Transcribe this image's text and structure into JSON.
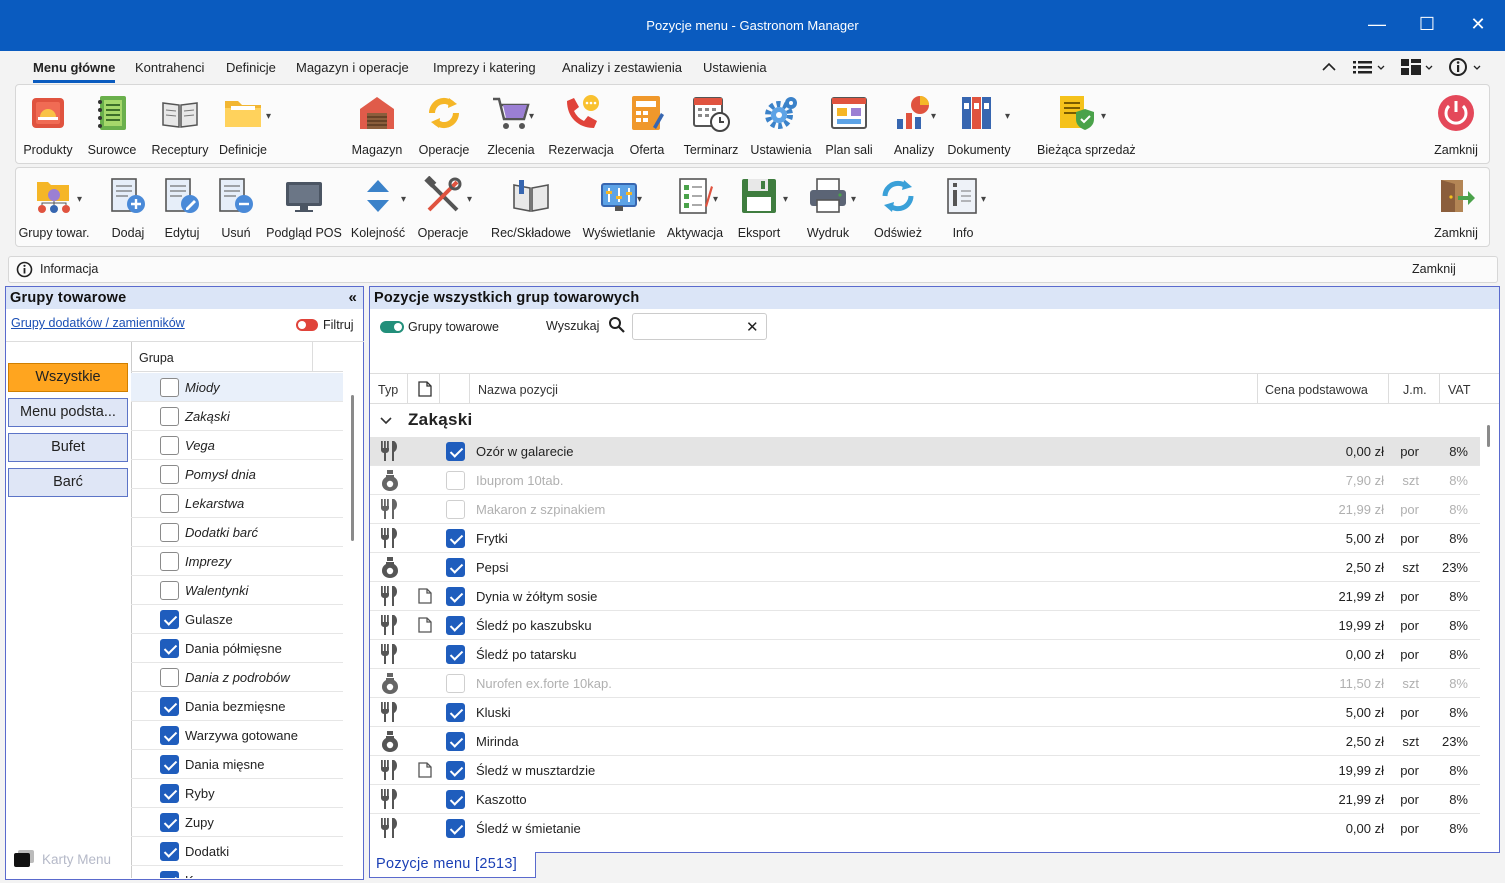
{
  "window": {
    "title": "Pozycje menu - Gastronom Manager",
    "min": "—",
    "max": "☐",
    "close": "✕"
  },
  "menu_tabs": [
    "Menu główne",
    "Kontrahenci",
    "Definicje",
    "Magazyn i operacje",
    "Imprezy i katering",
    "Analizy i zestawienia",
    "Ustawienia"
  ],
  "ribbon1": {
    "items": [
      "Produkty",
      "Surowce",
      "Receptury",
      "Definicje",
      "Magazyn",
      "Operacje",
      "Zlecenia",
      "Rezerwacja",
      "Oferta",
      "Terminarz",
      "Ustawienia",
      "Plan sali",
      "Analizy",
      "Dokumenty",
      "Bieżąca sprzedaż"
    ],
    "close": "Zamknij"
  },
  "ribbon2": {
    "items": [
      "Grupy towar.",
      "Dodaj",
      "Edytuj",
      "Usuń",
      "Podgląd POS",
      "Kolejność",
      "Operacje",
      "Rec/Składowe",
      "Wyświetlanie",
      "Aktywacja",
      "Eksport",
      "Wydruk",
      "Odśwież",
      "Info"
    ],
    "close": "Zamknij"
  },
  "info": {
    "label": "Informacja",
    "close": "Zamknij"
  },
  "left": {
    "title": "Grupy towarowe",
    "collapse": "«",
    "link": "Grupy dodatków / zamienników",
    "filter": "Filtruj",
    "col": "Grupa",
    "buttons": [
      "Wszystkie",
      "Menu podsta...",
      "Bufet",
      "Barć"
    ],
    "groups": [
      {
        "name": "Miody",
        "on": false
      },
      {
        "name": "Zakąski",
        "on": false
      },
      {
        "name": "Vega",
        "on": false
      },
      {
        "name": "Pomysł dnia",
        "on": false
      },
      {
        "name": "Lekarstwa",
        "on": false
      },
      {
        "name": "Dodatki barć",
        "on": false
      },
      {
        "name": "Imprezy",
        "on": false
      },
      {
        "name": "Walentynki",
        "on": false
      },
      {
        "name": "Gulasze",
        "on": true
      },
      {
        "name": "Dania półmięsne",
        "on": true
      },
      {
        "name": "Dania z podrobów",
        "on": false
      },
      {
        "name": "Dania bezmięsne",
        "on": true
      },
      {
        "name": "Warzywa gotowane",
        "on": true
      },
      {
        "name": "Dania mięsne",
        "on": true
      },
      {
        "name": "Ryby",
        "on": true
      },
      {
        "name": "Zupy",
        "on": true
      },
      {
        "name": "Dodatki",
        "on": true
      },
      {
        "name": "Kawy",
        "on": true
      }
    ],
    "karty": "Karty Menu"
  },
  "right": {
    "title": "Pozycje wszystkich grup towarowych",
    "toggle": "Grupy towarowe",
    "search_label": "Wyszukaj",
    "search_value": "",
    "cols": {
      "typ": "Typ",
      "name": "Nazwa pozycji",
      "price": "Cena podstawowa",
      "unit": "J.m.",
      "vat": "VAT"
    },
    "group": "Zakąski",
    "rows": [
      {
        "t": "fork",
        "doc": false,
        "on": true,
        "dim": false,
        "name": "Ozór w galarecie",
        "price": "0,00 zł",
        "unit": "por",
        "vat": "8%"
      },
      {
        "t": "bottle",
        "doc": false,
        "on": false,
        "dim": true,
        "name": "Ibuprom 10tab.",
        "price": "7,90 zł",
        "unit": "szt",
        "vat": "8%"
      },
      {
        "t": "fork",
        "doc": false,
        "on": false,
        "dim": true,
        "name": "Makaron z szpinakiem",
        "price": "21,99 zł",
        "unit": "por",
        "vat": "8%"
      },
      {
        "t": "fork",
        "doc": false,
        "on": true,
        "dim": false,
        "name": "Frytki",
        "price": "5,00 zł",
        "unit": "por",
        "vat": "8%"
      },
      {
        "t": "bottle",
        "doc": false,
        "on": true,
        "dim": false,
        "name": "Pepsi",
        "price": "2,50 zł",
        "unit": "szt",
        "vat": "23%"
      },
      {
        "t": "fork",
        "doc": true,
        "on": true,
        "dim": false,
        "name": "Dynia w żółtym sosie",
        "price": "21,99 zł",
        "unit": "por",
        "vat": "8%"
      },
      {
        "t": "fork",
        "doc": true,
        "on": true,
        "dim": false,
        "name": "Śledź po kaszubsku",
        "price": "19,99 zł",
        "unit": "por",
        "vat": "8%"
      },
      {
        "t": "fork",
        "doc": false,
        "on": true,
        "dim": false,
        "name": "Śledź po tatarsku",
        "price": "0,00 zł",
        "unit": "por",
        "vat": "8%"
      },
      {
        "t": "bottle",
        "doc": false,
        "on": false,
        "dim": true,
        "name": "Nurofen ex.forte 10kap.",
        "price": "11,50 zł",
        "unit": "szt",
        "vat": "8%"
      },
      {
        "t": "fork",
        "doc": false,
        "on": true,
        "dim": false,
        "name": "Kluski",
        "price": "5,00 zł",
        "unit": "por",
        "vat": "8%"
      },
      {
        "t": "bottle",
        "doc": false,
        "on": true,
        "dim": false,
        "name": "Mirinda",
        "price": "2,50 zł",
        "unit": "szt",
        "vat": "23%"
      },
      {
        "t": "fork",
        "doc": true,
        "on": true,
        "dim": false,
        "name": "Śledź w musztardzie",
        "price": "19,99 zł",
        "unit": "por",
        "vat": "8%"
      },
      {
        "t": "fork",
        "doc": false,
        "on": true,
        "dim": false,
        "name": "Kaszotto",
        "price": "21,99 zł",
        "unit": "por",
        "vat": "8%"
      },
      {
        "t": "fork",
        "doc": false,
        "on": true,
        "dim": false,
        "name": "Śledź w śmietanie",
        "price": "0,00 zł",
        "unit": "por",
        "vat": "8%"
      }
    ]
  },
  "bottom_tab": "Pozycje menu [2513]",
  "colors": {
    "accent": "#0a5bbf",
    "selected": "#ffa51f",
    "panel_border": "#5a6acd"
  }
}
